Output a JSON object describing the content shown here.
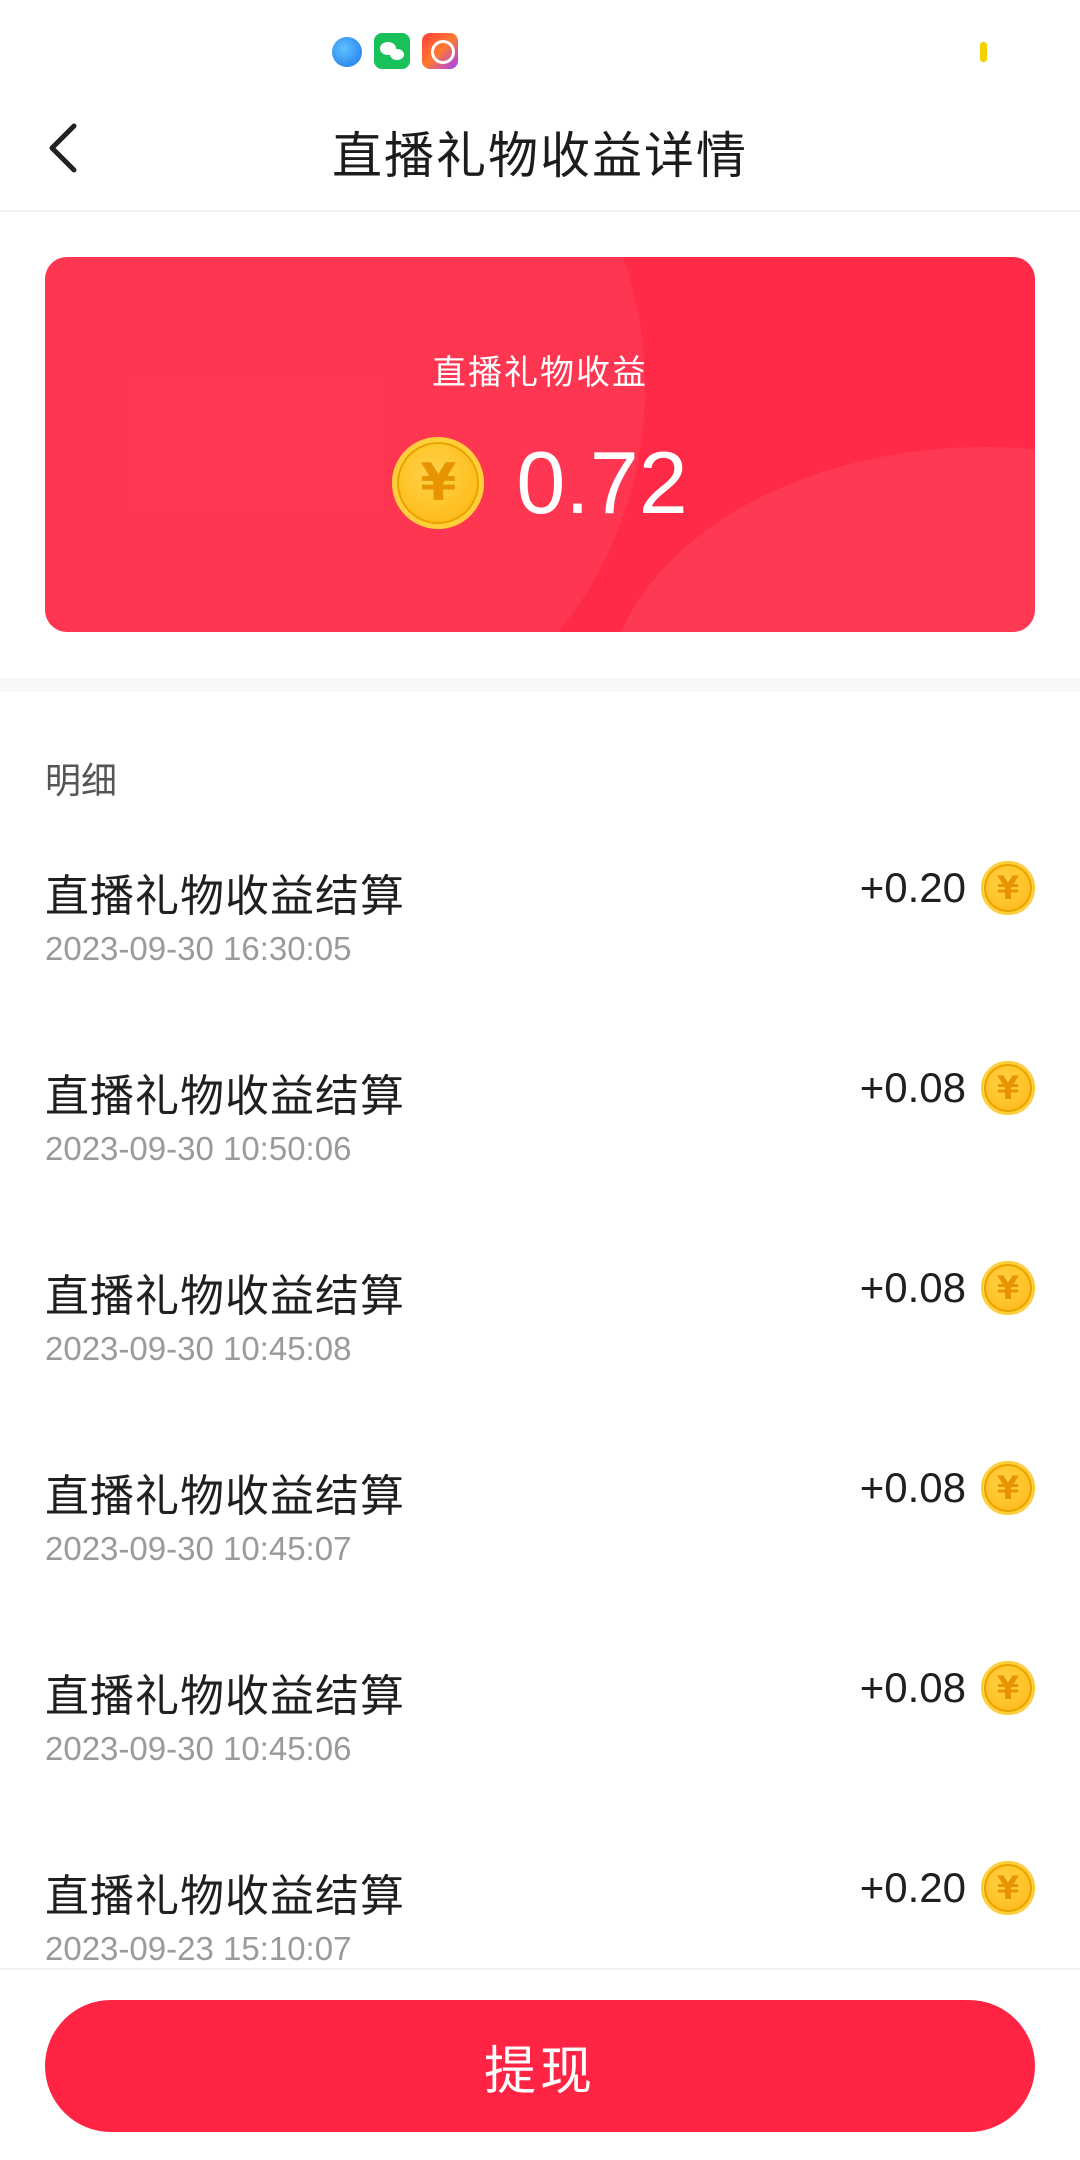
{
  "status_bar": {
    "icons": [
      "blue-app-icon",
      "wechat-icon",
      "kuaishou-icon"
    ],
    "indicator_color": "#f4d000"
  },
  "header": {
    "back_icon": "chevron-left-icon",
    "title": "直播礼物收益详情"
  },
  "summary": {
    "label": "直播礼物收益",
    "amount": "0.72",
    "coin_symbol": "¥",
    "card_color": "#fe2a48"
  },
  "details": {
    "section_label": "明细",
    "items": [
      {
        "title": "直播礼物收益结算",
        "time": "2023-09-30 16:30:05",
        "amount": "+0.20",
        "coin_symbol": "¥"
      },
      {
        "title": "直播礼物收益结算",
        "time": "2023-09-30 10:50:06",
        "amount": "+0.08",
        "coin_symbol": "¥"
      },
      {
        "title": "直播礼物收益结算",
        "time": "2023-09-30 10:45:08",
        "amount": "+0.08",
        "coin_symbol": "¥"
      },
      {
        "title": "直播礼物收益结算",
        "time": "2023-09-30 10:45:07",
        "amount": "+0.08",
        "coin_symbol": "¥"
      },
      {
        "title": "直播礼物收益结算",
        "time": "2023-09-30 10:45:06",
        "amount": "+0.08",
        "coin_symbol": "¥"
      },
      {
        "title": "直播礼物收益结算",
        "time": "2023-09-23 15:10:07",
        "amount": "+0.20",
        "coin_symbol": "¥"
      }
    ]
  },
  "footer": {
    "withdraw_label": "提现",
    "button_color": "#ff2443"
  }
}
